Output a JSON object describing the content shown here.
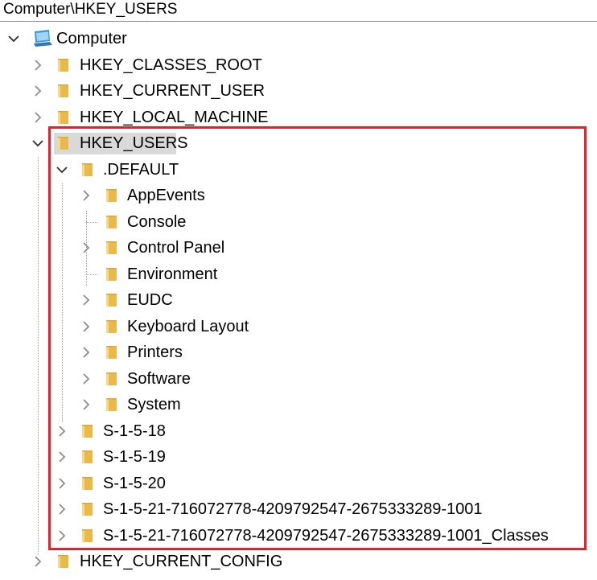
{
  "address_bar": {
    "path": "Computer\\HKEY_USERS"
  },
  "colors": {
    "highlight_border": "#e8202a",
    "selection_bg": "#d9d9d9",
    "folder": "#f0c24d"
  },
  "tree": {
    "root": {
      "label": "Computer",
      "icon": "computer-icon",
      "expanded": true
    },
    "hives": [
      {
        "label": "HKEY_CLASSES_ROOT",
        "expanded": false
      },
      {
        "label": "HKEY_CURRENT_USER",
        "expanded": false
      },
      {
        "label": "HKEY_LOCAL_MACHINE",
        "expanded": false
      },
      {
        "label": "HKEY_USERS",
        "expanded": true,
        "selected": true
      },
      {
        "label": "HKEY_CURRENT_CONFIG",
        "expanded": false
      }
    ],
    "users": [
      {
        "label": ".DEFAULT",
        "expanded": true
      },
      {
        "label": "S-1-5-18",
        "expanded": false
      },
      {
        "label": "S-1-5-19",
        "expanded": false
      },
      {
        "label": "S-1-5-20",
        "expanded": false
      },
      {
        "label": "S-1-5-21-716072778-4209792547-2675333289-1001",
        "expanded": false
      },
      {
        "label": "S-1-5-21-716072778-4209792547-2675333289-1001_Classes",
        "expanded": false
      }
    ],
    "default_children": [
      {
        "label": "AppEvents",
        "has_children": true
      },
      {
        "label": "Console",
        "has_children": false
      },
      {
        "label": "Control Panel",
        "has_children": true
      },
      {
        "label": "Environment",
        "has_children": false
      },
      {
        "label": "EUDC",
        "has_children": true
      },
      {
        "label": "Keyboard Layout",
        "has_children": true
      },
      {
        "label": "Printers",
        "has_children": true
      },
      {
        "label": "Software",
        "has_children": true
      },
      {
        "label": "System",
        "has_children": true
      }
    ]
  }
}
